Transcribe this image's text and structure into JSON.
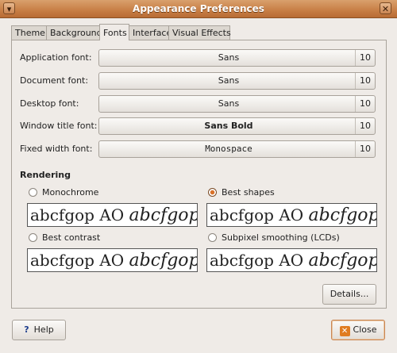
{
  "window": {
    "title": "Appearance Preferences"
  },
  "tabs": [
    "Theme",
    "Background",
    "Fonts",
    "Interface",
    "Visual Effects"
  ],
  "active_tab": "Fonts",
  "fonts": [
    {
      "label": "Application font:",
      "font": "Sans",
      "size": "10"
    },
    {
      "label": "Document font:",
      "font": "Sans",
      "size": "10"
    },
    {
      "label": "Desktop font:",
      "font": "Sans",
      "size": "10"
    },
    {
      "label": "Window title font:",
      "font": "Sans Bold",
      "size": "10"
    },
    {
      "label": "Fixed width font:",
      "font": "Monospace",
      "size": "10"
    }
  ],
  "rendering": {
    "heading": "Rendering",
    "options": [
      {
        "label": "Monochrome",
        "selected": false
      },
      {
        "label": "Best shapes",
        "selected": true
      },
      {
        "label": "Best contrast",
        "selected": false
      },
      {
        "label": "Subpixel smoothing (LCDs)",
        "selected": false
      }
    ],
    "preview_text": "abcfgop AO",
    "preview_italic": "abcfgop"
  },
  "buttons": {
    "details": "Details...",
    "help": "Help",
    "close": "Close"
  }
}
